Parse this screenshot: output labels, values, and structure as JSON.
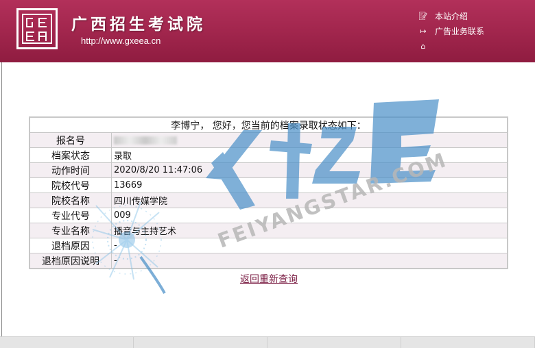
{
  "header": {
    "site_name": "广西招生考试院",
    "site_url": "http://www.gxeea.cn",
    "links": [
      {
        "icon": "edit-note-icon",
        "label": "本站介绍"
      },
      {
        "icon": "exit-arrow-icon",
        "label": "广告业务联系"
      },
      {
        "icon": "home-icon",
        "label": ""
      }
    ]
  },
  "watermark": {
    "brand": "飞扬之星",
    "text": "FEIYANGSTAR.COM",
    "color": "#4a90c8"
  },
  "record": {
    "greeting": "李博宁， 您好，您当前的档案录取状态如下：",
    "rows": [
      {
        "label": "报名号",
        "value": ""
      },
      {
        "label": "档案状态",
        "value": "录取"
      },
      {
        "label": "动作时间",
        "value": "2020/8/20 11:47:06"
      },
      {
        "label": "院校代号",
        "value": "13669"
      },
      {
        "label": "院校名称",
        "value": "四川传媒学院"
      },
      {
        "label": "专业代号",
        "value": "009"
      },
      {
        "label": "专业名称",
        "value": "播音与主持艺术"
      },
      {
        "label": "退档原因",
        "value": "-"
      },
      {
        "label": "退档原因说明",
        "value": "-"
      }
    ],
    "back_link": "返回重新查询"
  },
  "colors": {
    "header_bg": "#a0254c",
    "row_alt_bg": "#f4eef2",
    "link": "#7b1e44"
  }
}
